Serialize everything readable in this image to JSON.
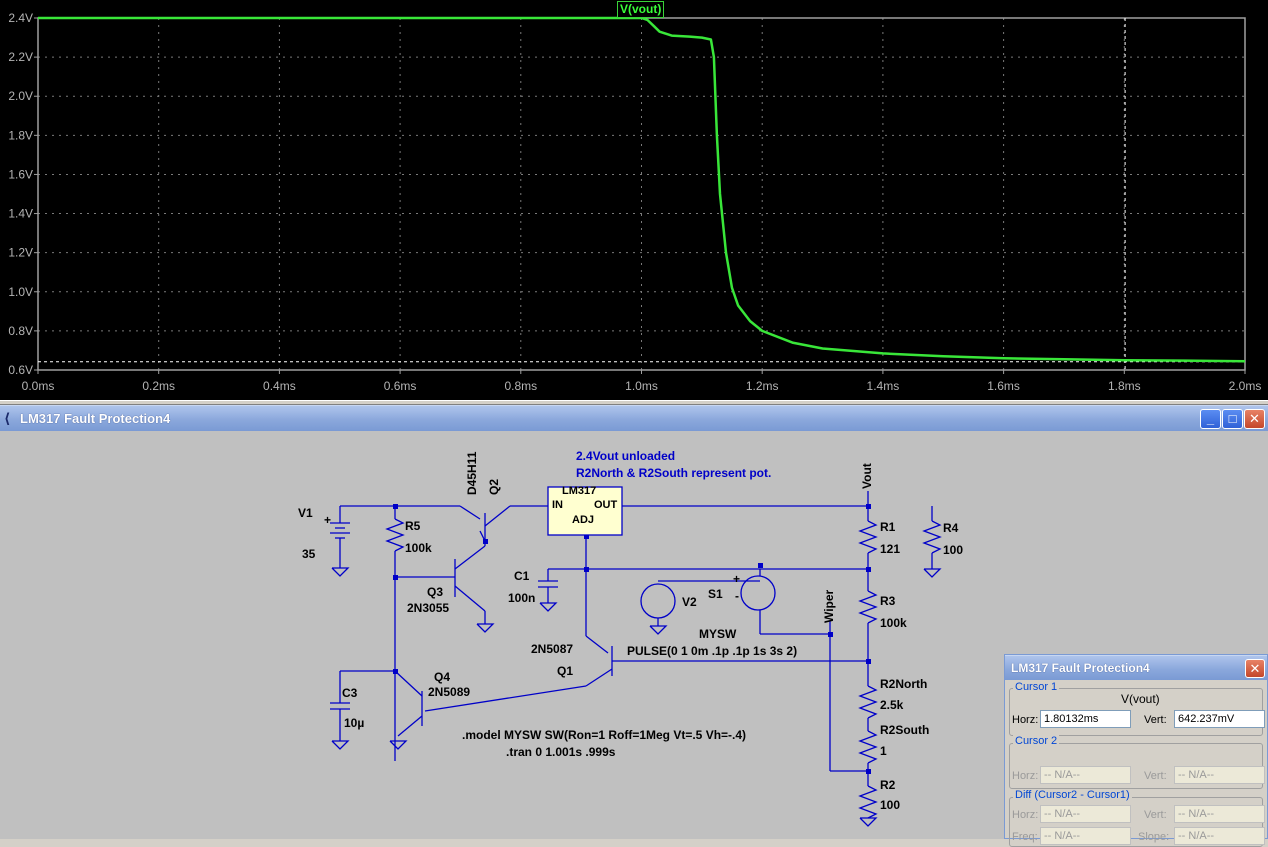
{
  "chart_data": {
    "type": "line",
    "trace_label": "V(vout)",
    "xlim": [
      0,
      2.0
    ],
    "ylim": [
      0.6,
      2.4
    ],
    "x_ticks": [
      "0.0ms",
      "0.2ms",
      "0.4ms",
      "0.6ms",
      "0.8ms",
      "1.0ms",
      "1.2ms",
      "1.4ms",
      "1.6ms",
      "1.8ms",
      "2.0ms"
    ],
    "y_ticks": [
      "0.6V",
      "0.8V",
      "1.0V",
      "1.2V",
      "1.4V",
      "1.6V",
      "1.8V",
      "2.0V",
      "2.2V",
      "2.4V"
    ],
    "grid": true,
    "series": [
      {
        "name": "V(vout)",
        "color": "#39e639",
        "points": [
          [
            0.0,
            2.4
          ],
          [
            1.0,
            2.4
          ],
          [
            1.01,
            2.39
          ],
          [
            1.02,
            2.36
          ],
          [
            1.03,
            2.33
          ],
          [
            1.05,
            2.31
          ],
          [
            1.08,
            2.305
          ],
          [
            1.1,
            2.3
          ],
          [
            1.115,
            2.29
          ],
          [
            1.12,
            2.2
          ],
          [
            1.125,
            1.8
          ],
          [
            1.13,
            1.5
          ],
          [
            1.14,
            1.2
          ],
          [
            1.15,
            1.02
          ],
          [
            1.16,
            0.93
          ],
          [
            1.18,
            0.85
          ],
          [
            1.2,
            0.8
          ],
          [
            1.25,
            0.74
          ],
          [
            1.3,
            0.71
          ],
          [
            1.4,
            0.685
          ],
          [
            1.5,
            0.67
          ],
          [
            1.6,
            0.66
          ],
          [
            1.7,
            0.655
          ],
          [
            1.8,
            0.65
          ],
          [
            1.9,
            0.648
          ],
          [
            2.0,
            0.645
          ]
        ]
      }
    ],
    "cursor": {
      "x": 1.80132,
      "y": 0.642237
    }
  },
  "schematic_window": {
    "title": "LM317 Fault Protection4",
    "icon": "ltspice-icon",
    "buttons": {
      "minimize": "_",
      "maximize": "□",
      "close": "✕"
    }
  },
  "schematic": {
    "note1": "2.4Vout unloaded",
    "note2": "R2North & R2South represent pot.",
    "model": ".model MYSW SW(Ron=1 Roff=1Meg Vt=.5 Vh=-.4)",
    "tran": ".tran 0 1.001s .999s",
    "pulse": "PULSE(0 1 0m .1p .1p 1s 3s 2)",
    "v1": "V1",
    "v1_val": "35",
    "r5": "R5",
    "r5_val": "100k",
    "q2_part": "D45H11",
    "q2": "Q2",
    "q3": "Q3",
    "q3_part": "2N3055",
    "lm317": "LM317",
    "in": "IN",
    "out": "OUT",
    "adj": "ADJ",
    "c1": "C1",
    "c1_val": "100n",
    "v2": "V2",
    "s1": "S1",
    "mysw": "MYSW",
    "q1_part": "2N5087",
    "q1": "Q1",
    "q4": "Q4",
    "q4_part": "2N5089",
    "c3": "C3",
    "c3_val": "10µ",
    "vout": "Vout",
    "wiper": "Wiper",
    "r1": "R1",
    "r1_val": "121",
    "r3": "R3",
    "r3_val": "100k",
    "r2north": "R2North",
    "r2north_val": "2.5k",
    "r2south": "R2South",
    "r2south_val": "1",
    "r2": "R2",
    "r2_val": "100",
    "r4": "R4",
    "r4_val": "100",
    "plus": "+",
    "minus": "-"
  },
  "cursor_window": {
    "title": "LM317 Fault Protection4",
    "close": "✕",
    "cursor1": {
      "label": "Cursor 1",
      "trace": "V(vout)",
      "horz_label": "Horz:",
      "horz": "1.80132ms",
      "vert_label": "Vert:",
      "vert": "642.237mV"
    },
    "cursor2": {
      "label": "Cursor 2",
      "horz_label": "Horz:",
      "horz": "-- N/A--",
      "vert_label": "Vert:",
      "vert": "-- N/A--"
    },
    "diff": {
      "label": "Diff (Cursor2 - Cursor1)",
      "horz_label": "Horz:",
      "horz": "-- N/A--",
      "vert_label": "Vert:",
      "vert": "-- N/A--",
      "freq_label": "Freq:",
      "freq": "-- N/A--",
      "slope_label": "Slope:",
      "slope": "-- N/A--"
    }
  }
}
